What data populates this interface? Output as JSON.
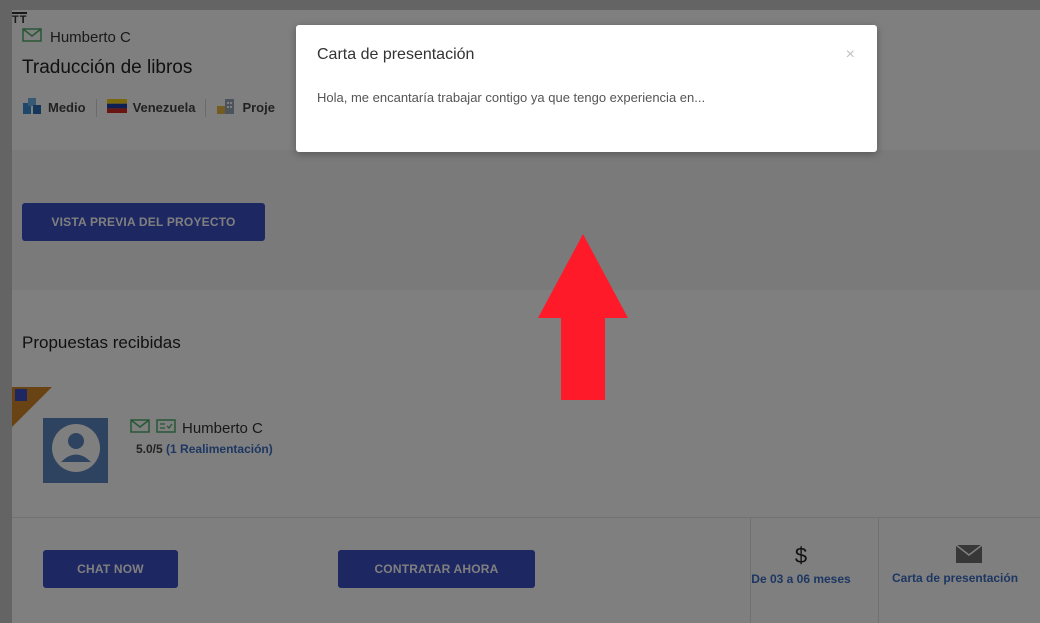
{
  "header": {
    "tt_mark": "TT",
    "user_name": "Humberto C",
    "project_title": "Traducción de libros",
    "meta": {
      "level": "Medio",
      "country": "Venezuela",
      "project_type": "Proje"
    }
  },
  "actions": {
    "preview_label": "VISTA PREVIA DEL PROYECTO",
    "chat_label": "CHAT NOW",
    "hire_label": "CONTRATAR AHORA"
  },
  "proposals": {
    "section_label": "Propuestas recibidas",
    "freelancer_name": "Humberto C",
    "rating": "5.0/5",
    "feedback_link": "(1 Realimentación)",
    "duration_symbol": "$",
    "duration": "De 03 a 06 meses",
    "cover_letter_label": "Carta de presentación"
  },
  "modal": {
    "title": "Carta de presentación",
    "close_symbol": "×",
    "body": "Hola, me encantaría trabajar contigo ya que tengo experiencia en..."
  },
  "colors": {
    "primary_button": "#3b4fc4",
    "arrow": "#ff1a2a",
    "link": "#3b6ec4",
    "avatar_bg": "#5a86c0",
    "badge": "#d4862b"
  },
  "icons": {
    "envelope": "envelope-icon",
    "verified": "verified-id-icon",
    "level": "level-blocks-icon",
    "flag": "venezuela-flag-icon",
    "building": "building-icon",
    "user_avatar": "user-avatar-icon",
    "dollar": "dollar-icon",
    "mail": "mail-icon",
    "up_arrow": "up-arrow-icon"
  }
}
